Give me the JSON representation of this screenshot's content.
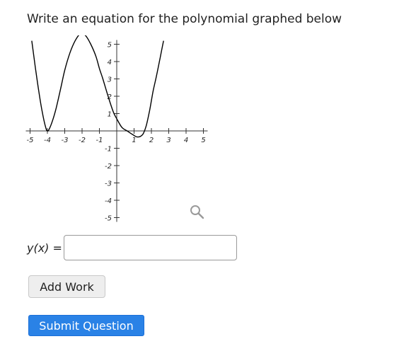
{
  "question": {
    "prompt": "Write an equation for the polynomial graphed below"
  },
  "answer": {
    "label_func": "y(x)",
    "label_eq": " =",
    "value": "",
    "placeholder": ""
  },
  "buttons": {
    "add_work": "Add Work",
    "submit": "Submit Question"
  },
  "icons": {
    "zoom": "magnifier-icon"
  },
  "colors": {
    "primary": "#2a82e6",
    "curve": "#000000",
    "axis": "#333333"
  },
  "chart_data": {
    "type": "line",
    "xlim": [
      -5,
      5
    ],
    "ylim": [
      -5,
      5
    ],
    "x_ticks": [
      -5,
      -4,
      -3,
      -2,
      -1,
      1,
      2,
      3,
      4,
      5
    ],
    "y_ticks": [
      -5,
      -4,
      -3,
      -2,
      -1,
      1,
      2,
      3,
      4,
      5
    ],
    "x_tick_labels": [
      "-5",
      "-4",
      "-3",
      "-2",
      "-1",
      "1",
      "2",
      "3",
      "4",
      "5"
    ],
    "y_tick_labels": [
      "-5",
      "-4",
      "-3",
      "-2",
      "-1",
      "1",
      "2",
      "3",
      "4",
      "5"
    ],
    "grid": false,
    "series": [
      {
        "x": [
          -4.9,
          -4.7,
          -4.5,
          -4.3,
          -4.1,
          -4.0,
          -3.9,
          -3.7,
          -3.5,
          -3.2,
          -3.0,
          -2.7,
          -2.4,
          -2.1,
          -1.8,
          -1.5,
          -1.2,
          -1.0,
          -0.8,
          -0.5,
          -0.2,
          0.0,
          0.3,
          0.6,
          0.9,
          1.2,
          1.5,
          1.7,
          1.9,
          2.1,
          2.3,
          2.5,
          2.7
        ],
        "y": [
          5.2,
          3.7,
          2.3,
          1.1,
          0.2,
          0.0,
          0.1,
          0.6,
          1.3,
          2.6,
          3.5,
          4.5,
          5.2,
          5.6,
          5.5,
          5.0,
          4.3,
          3.6,
          3.0,
          2.0,
          1.1,
          0.7,
          0.2,
          0.0,
          -0.2,
          -0.35,
          -0.2,
          0.3,
          1.2,
          2.3,
          3.2,
          4.2,
          5.2
        ]
      }
    ]
  }
}
